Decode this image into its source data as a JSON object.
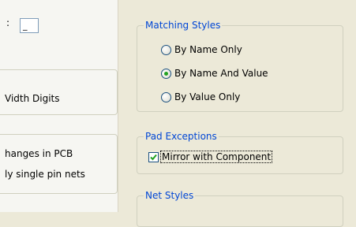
{
  "left_panel": {
    "colon": ":",
    "field_value": "_",
    "width_digits_label": "Vidth Digits",
    "changes_in_pcb_label": "hanges in PCB",
    "single_pin_nets_label": "ly single pin nets"
  },
  "matching_styles": {
    "title": "Matching Styles",
    "options": [
      {
        "label": "By Name Only",
        "selected": false
      },
      {
        "label": "By Name And Value",
        "selected": true
      },
      {
        "label": "By Value Only",
        "selected": false
      }
    ]
  },
  "pad_exceptions": {
    "title": "Pad Exceptions",
    "mirror_label": "Mirror with Component",
    "mirror_checked": true
  },
  "net_styles": {
    "title": "Net Styles"
  },
  "colors": {
    "group_title": "#0046D5",
    "radio_dot": "#21A121",
    "check_mark": "#21A121"
  }
}
